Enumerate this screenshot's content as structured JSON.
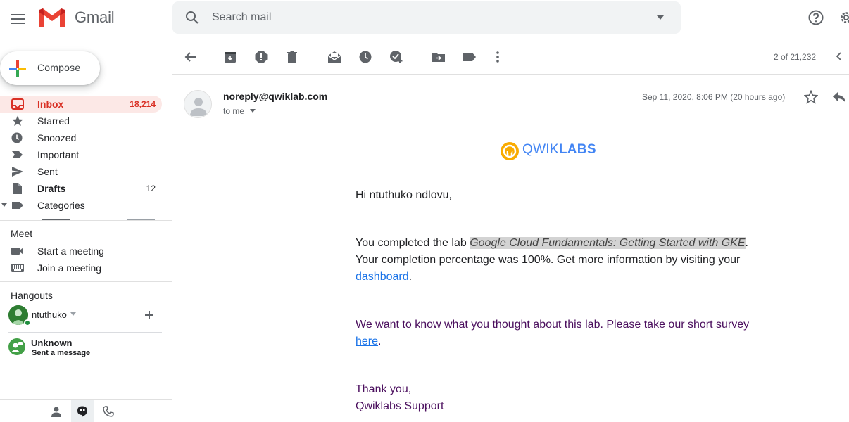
{
  "app": {
    "name": "Gmail"
  },
  "header": {
    "search_placeholder": "Search mail"
  },
  "sidebar": {
    "compose_label": "Compose",
    "items": [
      {
        "label": "Inbox",
        "count": "18,214"
      },
      {
        "label": "Starred",
        "count": ""
      },
      {
        "label": "Snoozed",
        "count": ""
      },
      {
        "label": "Important",
        "count": ""
      },
      {
        "label": "Sent",
        "count": ""
      },
      {
        "label": "Drafts",
        "count": "12"
      },
      {
        "label": "Categories",
        "count": ""
      }
    ],
    "meet": {
      "title": "Meet",
      "items": [
        {
          "label": "Start a meeting"
        },
        {
          "label": "Join a meeting"
        }
      ]
    },
    "hangouts": {
      "title": "Hangouts",
      "user": "ntuthuko",
      "contact_name": "Unknown",
      "contact_status": "Sent a message"
    }
  },
  "toolbar": {
    "page_count": "2 of 21,232"
  },
  "message": {
    "sender": "noreply@qwiklab.com",
    "recipient": "to me",
    "date": "Sep 11, 2020, 8:06 PM (20 hours ago)",
    "logo_text_light": "QWIK",
    "logo_text_bold": "LABS",
    "greeting": "Hi ntuthuko ndlovu,",
    "completed_prefix": "You completed the lab ",
    "lab_name": "Google Cloud Fundamentals: Getting Started with GKE",
    "completed_suffix": ". Your completion percentage was 100%. Get more information by visiting your ",
    "dashboard_link": "dashboard",
    "survey_prefix": "We want to know what you thought about this lab. Please take our short survey ",
    "survey_link": "here",
    "period": ".",
    "thanks": "Thank you,",
    "signature": "Qwiklabs Support"
  },
  "colors": {
    "inbox_accent": "#d93025",
    "link": "#1a73e8",
    "qwiklabs_blue": "#4285f4",
    "qwiklabs_yellow": "#f9ab00"
  }
}
